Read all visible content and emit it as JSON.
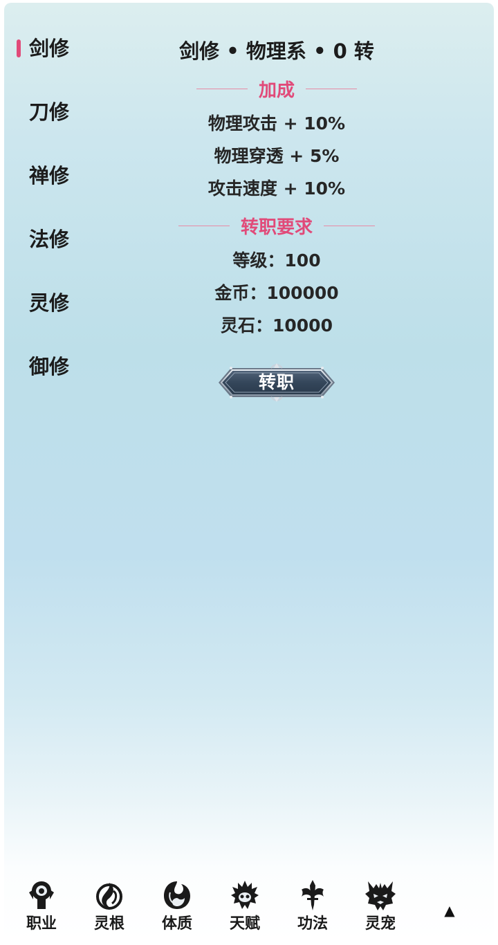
{
  "sidebar": {
    "active_index": 0,
    "items": [
      {
        "label": "剑修"
      },
      {
        "label": "刀修"
      },
      {
        "label": "禅修"
      },
      {
        "label": "法修"
      },
      {
        "label": "灵修"
      },
      {
        "label": "御修"
      }
    ]
  },
  "main": {
    "title": "剑修 • 物理系 • 0 转",
    "bonus_section": {
      "heading": "加成",
      "rows": [
        "物理攻击 + 10%",
        "物理穿透 + 5%",
        "攻击速度 + 10%"
      ]
    },
    "requirement_section": {
      "heading": "转职要求",
      "rows": [
        "等级：100",
        "金币：100000",
        "灵石：10000"
      ]
    },
    "transfer_button": "转职"
  },
  "bottom_nav": {
    "items": [
      {
        "label": "职业",
        "icon": "profession-icon"
      },
      {
        "label": "灵根",
        "icon": "spirit-root-icon"
      },
      {
        "label": "体质",
        "icon": "physique-icon"
      },
      {
        "label": "天赋",
        "icon": "talent-icon"
      },
      {
        "label": "功法",
        "icon": "technique-icon"
      },
      {
        "label": "灵宠",
        "icon": "spirit-pet-icon"
      }
    ],
    "scroll_top_glyph": "▲"
  },
  "colors": {
    "accent": "#e14a79",
    "button_fill": "#3a4a5a",
    "text": "#1c1c1c"
  }
}
